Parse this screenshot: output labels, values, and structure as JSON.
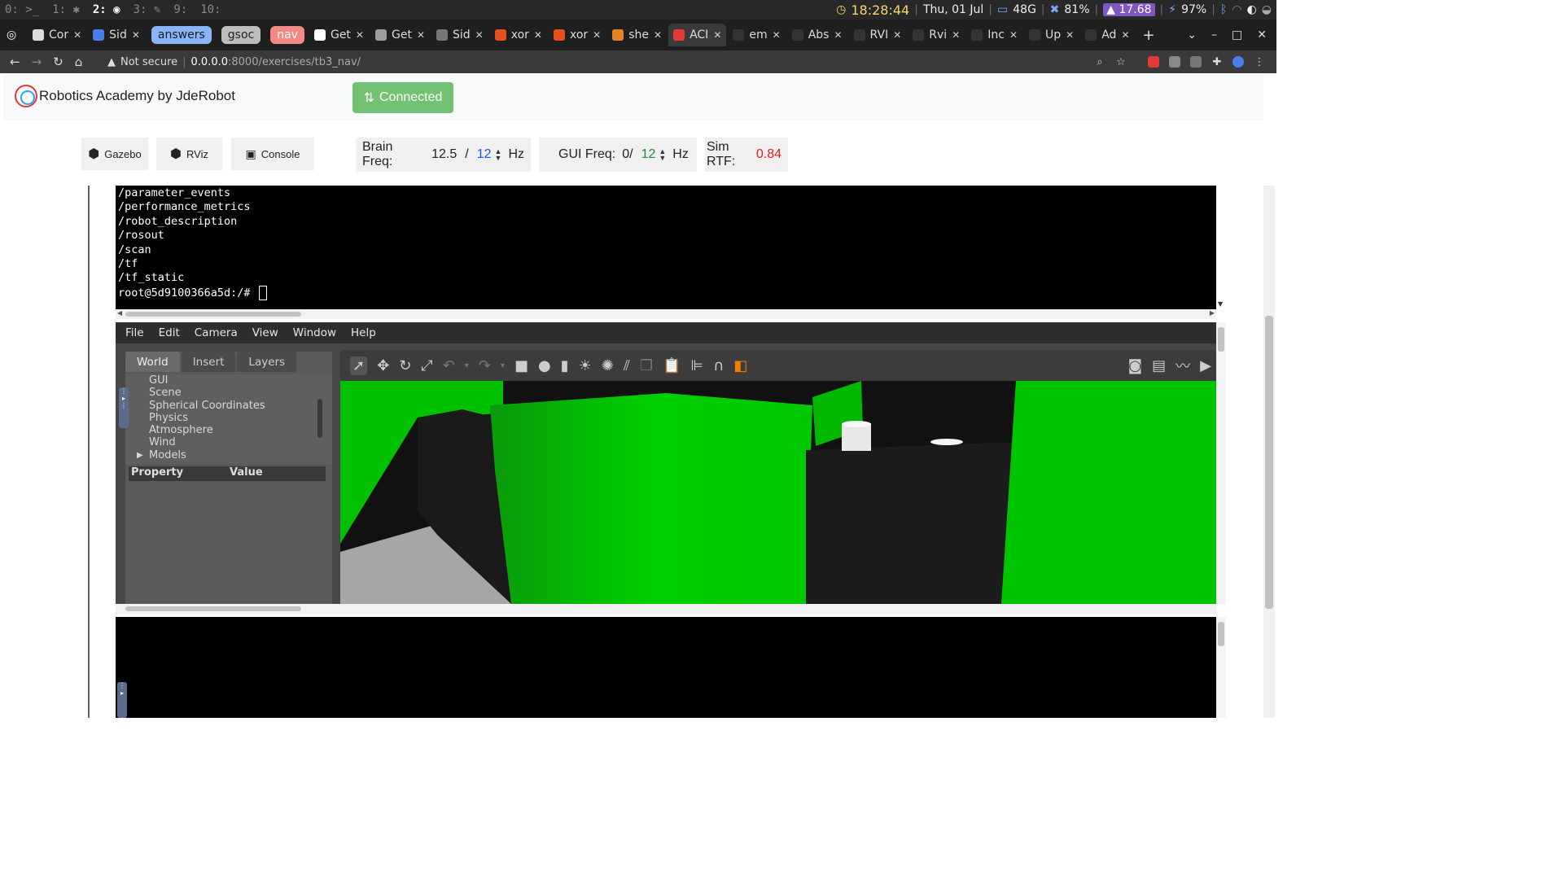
{
  "topbar": {
    "workspaces": [
      "0: >_",
      "1: ✱",
      "2:",
      "3: ✎",
      "9:",
      "10:"
    ],
    "clock": "18:28:44",
    "date": "Thu, 01 Jul",
    "disk": "48G",
    "cpu": "81%",
    "load": "17.68",
    "battery": "97%"
  },
  "tabs": [
    {
      "label": "Cor",
      "fav": "#ddd"
    },
    {
      "label": "Sid",
      "fav": "#4a7de8"
    },
    {
      "group": "answers",
      "color": "#8ab4f8"
    },
    {
      "group": "gsoc",
      "color": "#bdbdbd"
    },
    {
      "group": "nav",
      "color": "#f28b82"
    },
    {
      "label": "Get",
      "fav": "#ffffff"
    },
    {
      "label": "Get",
      "fav": "#9e9e9e"
    },
    {
      "label": "Sid",
      "fav": "#777"
    },
    {
      "label": "xor",
      "fav": "#e6501e"
    },
    {
      "label": "xor",
      "fav": "#e6501e"
    },
    {
      "label": "she",
      "fav": "#e48326"
    },
    {
      "label": "ACI",
      "fav": "#e53935",
      "active": true
    },
    {
      "label": "em",
      "fav": "#333"
    },
    {
      "label": "Abs",
      "fav": "#333"
    },
    {
      "label": "RVI",
      "fav": "#333"
    },
    {
      "label": "Rvi",
      "fav": "#333"
    },
    {
      "label": "Inc",
      "fav": "#333"
    },
    {
      "label": "Up",
      "fav": "#333"
    },
    {
      "label": "Ad",
      "fav": "#333"
    }
  ],
  "address": {
    "security": "Not secure",
    "host": "0.0.0.0",
    "path": ":8000/exercises/tb3_nav/"
  },
  "brand": "Robotics Academy by JdeRobot",
  "connected_label": "Connected",
  "toolbar": {
    "gazebo": "Gazebo",
    "rviz": "RViz",
    "console": "Console"
  },
  "brain": {
    "label": "Brain Freq:",
    "value": "12.5",
    "sep": "/",
    "target": "12",
    "unit": "Hz"
  },
  "gui": {
    "label": "GUI Freq:",
    "value": "0/",
    "target": "12",
    "unit": "Hz"
  },
  "rtf": {
    "label": "Sim RTF:",
    "value": "0.84"
  },
  "terminal_lines": [
    "/parameter_events",
    "/performance_metrics",
    "/robot_description",
    "/rosout",
    "/scan",
    "/tf",
    "/tf_static"
  ],
  "terminal_prompt": "root@5d9100366a5d:/# ",
  "gazebo": {
    "menu": [
      "File",
      "Edit",
      "Camera",
      "View",
      "Window",
      "Help"
    ],
    "tabs": [
      "World",
      "Insert",
      "Layers"
    ],
    "tree": [
      "GUI",
      "Scene",
      "Spherical Coordinates",
      "Physics",
      "Atmosphere",
      "Wind",
      "Models"
    ],
    "prop_header": {
      "property": "Property",
      "value": "Value"
    }
  }
}
